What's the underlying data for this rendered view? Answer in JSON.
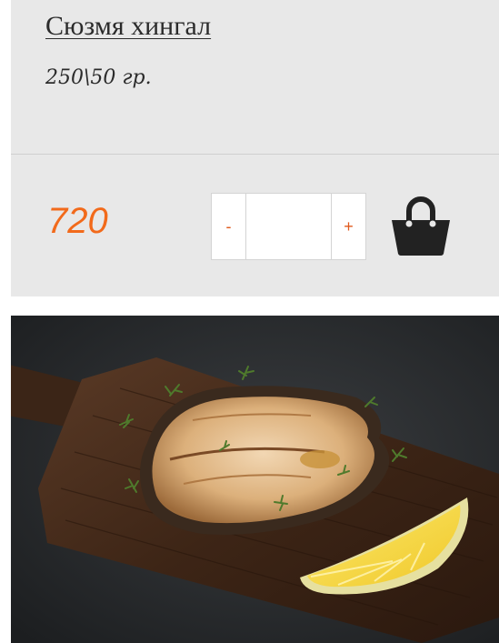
{
  "product": {
    "title": "Сюзмя хингал",
    "weight": "250\\50 гр.",
    "price": "720",
    "quantity": {
      "minus_label": "-",
      "plus_label": "+",
      "value": ""
    },
    "cart_icon": "shopping-bag-icon",
    "image_icon": "grilled-fish-steak-photo"
  },
  "colors": {
    "card_bg": "#e8e8e8",
    "price": "#f26a1b",
    "qty_controls": "#e05a1d",
    "text": "#2b2b2b",
    "icon": "#222222"
  }
}
